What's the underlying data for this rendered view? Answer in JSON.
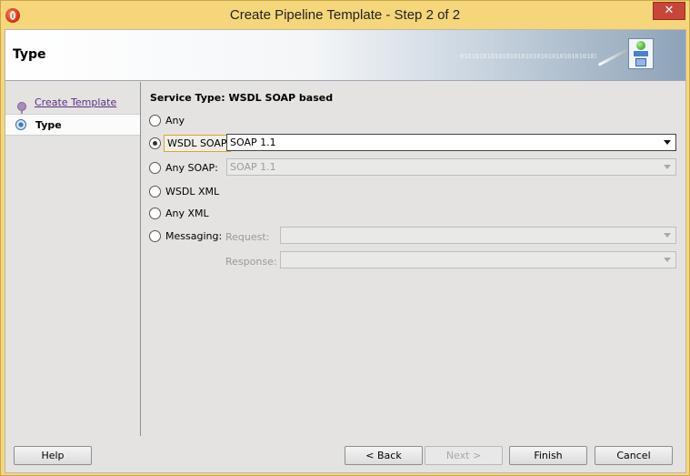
{
  "window": {
    "title": "Create Pipeline Template - Step 2 of 2",
    "close_glyph": "✕"
  },
  "header": {
    "title": "Type",
    "decor_binary": "0101010101010101010101010101010101010101"
  },
  "nav": {
    "items": [
      {
        "label": "Create Template",
        "state": "visited"
      },
      {
        "label": "Type",
        "state": "current"
      }
    ]
  },
  "form": {
    "section_title": "Service Type: WSDL SOAP based",
    "options": {
      "any": {
        "label": "Any",
        "checked": false
      },
      "wsdl_soap": {
        "label": "WSDL SOAP",
        "checked": true
      },
      "any_soap": {
        "label": "Any SOAP:",
        "checked": false
      },
      "wsdl_xml": {
        "label": "WSDL XML",
        "checked": false
      },
      "any_xml": {
        "label": "Any XML",
        "checked": false
      },
      "messaging": {
        "label": "Messaging:",
        "checked": false
      }
    },
    "wsdl_soap_version": "SOAP 1.1",
    "any_soap_version": "SOAP 1.1",
    "request_label": "Request:",
    "request_value": "",
    "response_label": "Response:",
    "response_value": ""
  },
  "buttons": {
    "help": "Help",
    "back": "< Back",
    "next": "Next >",
    "finish": "Finish",
    "cancel": "Cancel"
  },
  "colors": {
    "title_bar": "#f5d67a",
    "accent_focus": "#e0a42e",
    "nav_link": "#5a2d82"
  }
}
